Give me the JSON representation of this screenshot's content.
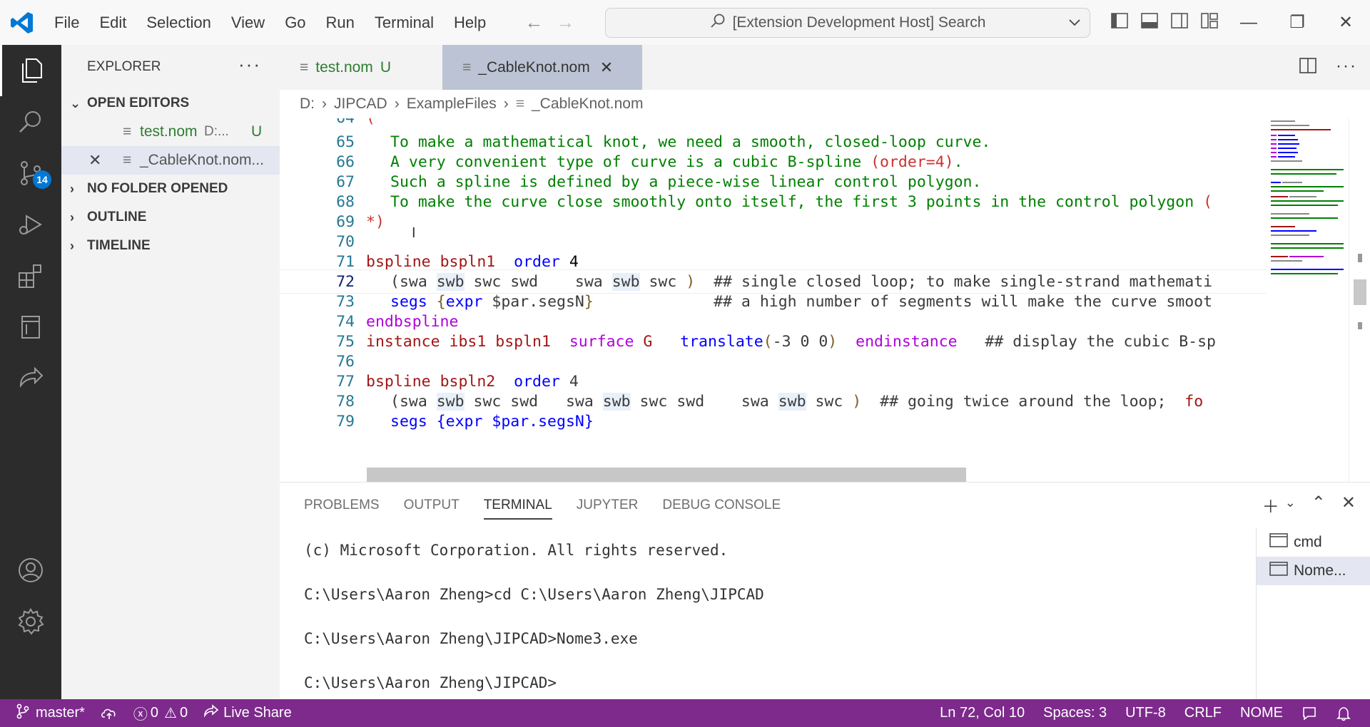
{
  "titlebar": {
    "menu": [
      "File",
      "Edit",
      "Selection",
      "View",
      "Go",
      "Run",
      "Terminal",
      "Help"
    ],
    "search": "[Extension Development Host] Search"
  },
  "activitybar": {
    "scm_badge": "14"
  },
  "sidebar": {
    "title": "EXPLORER",
    "open_editors": "OPEN EDITORS",
    "files": [
      {
        "name": "test.nom",
        "path": "D:...",
        "status": "U"
      },
      {
        "name": "_CableKnot.nom..."
      }
    ],
    "no_folder": "NO FOLDER OPENED",
    "outline": "OUTLINE",
    "timeline": "TIMELINE"
  },
  "tabs": [
    {
      "label": "test.nom",
      "status": "U"
    },
    {
      "label": "_CableKnot.nom"
    }
  ],
  "breadcrumb": [
    "D:",
    "JIPCAD",
    "ExampleFiles",
    "_CableKnot.nom"
  ],
  "editor": {
    "partial_top": "(",
    "lines": {
      "65": "To make a mathematical knot, we need a smooth, closed-loop curve.",
      "66": "A very convenient type of curve is a cubic B-spline ",
      "66b": "(order=4)",
      "66c": ".",
      "67": "Such a spline is defined by a piece-wise linear control polygon.",
      "68": "To make the curve close smoothly onto itself, the first 3 points in the control polygon ",
      "68b": "(",
      "69": "*)",
      "71a": "bspline",
      "71b": "bspln1",
      "71c": "order",
      "71d": "4",
      "72a": "(swa ",
      "72b": "swb",
      "72c": " swc swd    swa ",
      "72d": "swb",
      "72e": " swc ",
      "72f": ")",
      "72g": "## single closed loop; to make single-strand mathemati",
      "73a": "segs",
      "73b": "{",
      "73c": "expr",
      "73d": " $par.segsN",
      "73e": "}",
      "73f": "## a high number of segments will make the curve smoot",
      "74": "endbspline",
      "75a": "instance",
      "75b": "ibs1",
      "75c": "bspln1",
      "75d": "surface",
      "75e": "G",
      "75f": "translate",
      "75g": "(",
      "75h": "-3 0 0",
      "75i": ")",
      "75j": "endinstance",
      "75k": "## display the cubic B-sp",
      "77a": "bspline",
      "77b": "bspln2",
      "77c": "order",
      "77d": "4",
      "78a": "(swa ",
      "78b": "swb",
      "78c": " swc swd   swa ",
      "78d": "swb",
      "78e": " swc swd    swa ",
      "78f": "swb",
      "78g": " swc ",
      "78h": ")",
      "78i": "## going twice around the loop;  ",
      "78j": "fo",
      "79": "segs {expr $par.segsN}"
    },
    "line_numbers": [
      "64",
      "65",
      "66",
      "67",
      "68",
      "69",
      "70",
      "71",
      "72",
      "73",
      "74",
      "75",
      "76",
      "77",
      "78",
      "79"
    ]
  },
  "panel": {
    "tabs": [
      "PROBLEMS",
      "OUTPUT",
      "TERMINAL",
      "JUPYTER",
      "DEBUG CONSOLE"
    ],
    "terminal_lines": [
      "(c) Microsoft Corporation. All rights reserved.",
      "C:\\Users\\Aaron Zheng>cd C:\\Users\\Aaron Zheng\\JIPCAD",
      "C:\\Users\\Aaron Zheng\\JIPCAD>Nome3.exe",
      "C:\\Users\\Aaron Zheng\\JIPCAD>"
    ],
    "terminals": [
      "cmd",
      "Nome..."
    ]
  },
  "statusbar": {
    "branch": "master*",
    "errors": "0",
    "warnings": "0",
    "liveshare": "Live Share",
    "position": "Ln 72, Col 10",
    "spaces": "Spaces: 3",
    "encoding": "UTF-8",
    "eol": "CRLF",
    "language": "NOME"
  },
  "colors": {
    "statusbar": "#7d2a8c",
    "accent": "#0078d4",
    "comment": "#008000",
    "keyword": "#a31515"
  }
}
